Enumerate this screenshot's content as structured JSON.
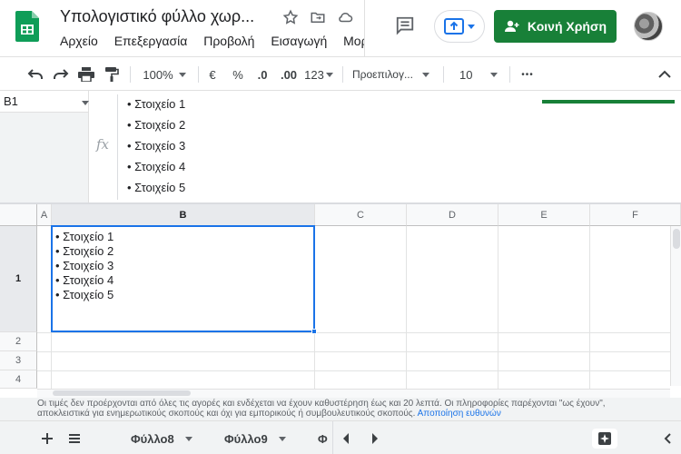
{
  "header": {
    "title": "Υπολογιστικό φύλλο χωρ...",
    "menu": [
      "Αρχείο",
      "Επεξεργασία",
      "Προβολή",
      "Εισαγωγή",
      "Μορ"
    ],
    "share_label": "Κοινή Χρήση"
  },
  "toolbar": {
    "zoom": "100%",
    "currency": "€",
    "percent": "%",
    "decrease_decimals": ".0",
    "increase_decimals": ".00",
    "more_formats": "123",
    "font": "Προεπιλογ...",
    "font_size": "10",
    "more": "•••"
  },
  "formula": {
    "cell_ref": "B1",
    "fx": "fx",
    "lines": [
      "• Στοιχείο 1",
      "• Στοιχείο 2",
      "• Στοιχείο 3",
      "• Στοιχείο 4",
      "• Στοιχείο 5"
    ]
  },
  "grid": {
    "columns": [
      "A",
      "B",
      "C",
      "D",
      "E",
      "F"
    ],
    "rows": [
      "1",
      "2",
      "3",
      "4"
    ],
    "b1_lines": [
      "• Στοιχείο 1",
      "• Στοιχείο 2",
      "• Στοιχείο 3",
      "• Στοιχείο 4",
      "• Στοιχείο 5"
    ]
  },
  "notice": {
    "text": "Οι τιμές δεν προέρχονται από όλες τις αγορές και ενδέχεται να έχουν καθυστέρηση έως και 20 λεπτά. Οι πληροφορίες παρέχονται \"ως έχουν\", αποκλειστικά για ενημερωτικούς σκοπούς και όχι για εμπορικούς ή συμβουλευτικούς σκοπούς.",
    "link": "Αποποίηση ευθυνών"
  },
  "sheets": {
    "tabs": [
      "Φύλλο8",
      "Φύλλο9",
      "Φ"
    ]
  },
  "colors": {
    "brand_green": "#188038",
    "selection_blue": "#1a73e8"
  }
}
